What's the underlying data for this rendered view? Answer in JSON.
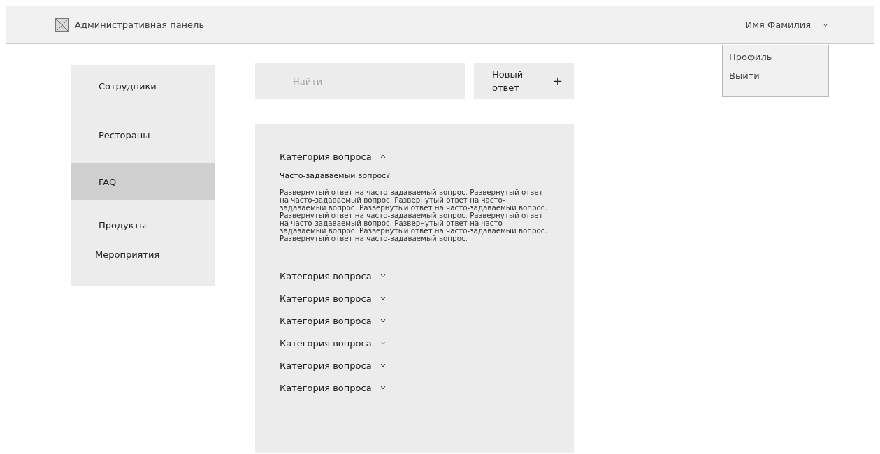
{
  "header": {
    "title": "Административная панель",
    "user": "Имя Фамилия",
    "menu_open": true
  },
  "user_menu": [
    "Профиль",
    "Выйти"
  ],
  "sidebar": {
    "items": [
      {
        "label": "Сотрудники",
        "selected": false
      },
      {
        "label": "Рестораны",
        "selected": false
      },
      {
        "label": "FAQ",
        "selected": true
      },
      {
        "label": "Продукты",
        "selected": false
      },
      {
        "label": "Мероприятия",
        "selected": false
      }
    ]
  },
  "search": {
    "placeholder": "Найти"
  },
  "new_button": {
    "label": "Новый ответ",
    "icon": "+"
  },
  "faq": [
    {
      "category": "Категория вопроса",
      "expanded": true,
      "question": "Часто-задаваемый вопрос?",
      "answer": "Развернутый ответ на часто-задаваемый вопрос. Развернутый ответ на часто-задаваемый вопрос. Развернутый ответ на часто-задаваемый вопрос. Развернутый ответ на часто-задаваемый вопрос. Развернутый ответ на часто-задаваемый вопрос. Развернутый ответ на часто-задаваемый вопрос. Развернутый ответ на часто-задаваемый вопрос. Развернутый ответ на часто-задаваемый вопрос. Развернутый ответ на часто-задаваемый вопрос."
    },
    {
      "category": "Категория вопроса",
      "expanded": false
    },
    {
      "category": "Категория вопроса",
      "expanded": false
    },
    {
      "category": "Категория вопроса",
      "expanded": false
    },
    {
      "category": "Категория вопроса",
      "expanded": false
    },
    {
      "category": "Категория вопроса",
      "expanded": false
    },
    {
      "category": "Категория вопроса",
      "expanded": false
    }
  ]
}
